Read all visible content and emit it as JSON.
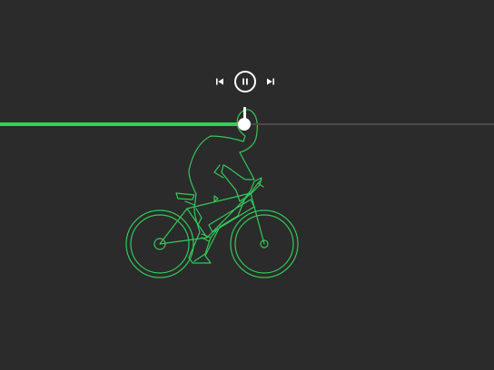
{
  "player": {
    "progress_fraction": 0.495,
    "controls": [
      {
        "name": "previous-track-button",
        "icon": "skip-previous-icon"
      },
      {
        "name": "pause-button",
        "icon": "pause-icon"
      },
      {
        "name": "next-track-button",
        "icon": "skip-next-icon"
      }
    ]
  },
  "illustration": {
    "subject": "cyclist-outline-icon"
  },
  "colors": {
    "background": "#2b2b2b",
    "accent_green": "#2fd35a",
    "outline_green": "#34c759",
    "track_rest": "#4a4a4a",
    "control_white": "#ffffff"
  }
}
